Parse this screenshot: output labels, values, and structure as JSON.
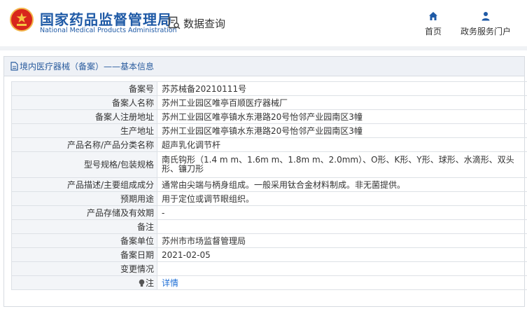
{
  "header": {
    "site_name_cn": "国家药品监督管理局",
    "site_name_en": "National Medical Products Administration",
    "query_label": "数据查询",
    "nav": [
      {
        "label": "首页",
        "icon": "home-icon"
      },
      {
        "label": "政务服务门户",
        "icon": "user-icon"
      }
    ]
  },
  "breadcrumb": "境内医疗器械（备案）——基本信息",
  "colors": {
    "brand_blue": "#1f5aa6",
    "link_blue": "#1f6fd6",
    "emblem_red": "#d8261c"
  },
  "record": {
    "rows": [
      {
        "key": "备案号",
        "value": "苏苏械备20210111号"
      },
      {
        "key": "备案人名称",
        "value": "苏州工业园区唯亭百顺医疗器械厂"
      },
      {
        "key": "备案人注册地址",
        "value": "苏州工业园区唯亭镇水东港路20号怡邻产业园南区3幢"
      },
      {
        "key": "生产地址",
        "value": "苏州工业园区唯亭镇水东港路20号怡邻产业园南区3幢"
      },
      {
        "key": "产品名称/产品分类名称",
        "value": "超声乳化调节杆"
      },
      {
        "key": "型号规格/包装规格",
        "value": "南氏钩形（1.4 m m、1.6m m、1.8m m、2.0mm）、O形、K形、Y形、球形、水滴形、双头形、镰刀形"
      },
      {
        "key": "产品描述/主要组成成分",
        "value": "通常由尖端与柄身组成。一般采用钛合金材料制成。非无菌提供。"
      },
      {
        "key": "预期用途",
        "value": "用于定位或调节眼组织。"
      },
      {
        "key": "产品存储及有效期",
        "value": "-"
      },
      {
        "key": "备注",
        "value": ""
      },
      {
        "key": "备案单位",
        "value": "苏州市市场监督管理局"
      },
      {
        "key": "备案日期",
        "value": "2021-02-05"
      },
      {
        "key": "变更情况",
        "value": ""
      }
    ],
    "note_key": "注",
    "note_link": "详情"
  }
}
